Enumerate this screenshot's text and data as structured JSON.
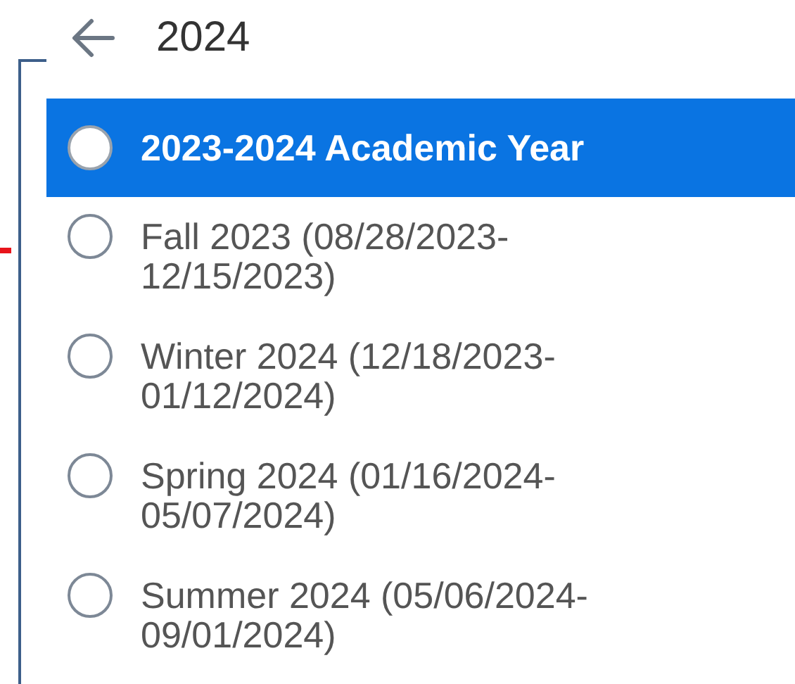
{
  "header": {
    "title": "2024"
  },
  "options": [
    {
      "label": "2023-2024 Academic Year",
      "selected": true
    },
    {
      "label": "Fall 2023 (08/28/2023-12/15/2023)",
      "selected": false
    },
    {
      "label": "Winter 2024 (12/18/2023-01/12/2024)",
      "selected": false
    },
    {
      "label": "Spring 2024 (01/16/2024-05/07/2024)",
      "selected": false
    },
    {
      "label": "Summer 2024 (05/06/2024-09/01/2024)",
      "selected": false
    }
  ]
}
